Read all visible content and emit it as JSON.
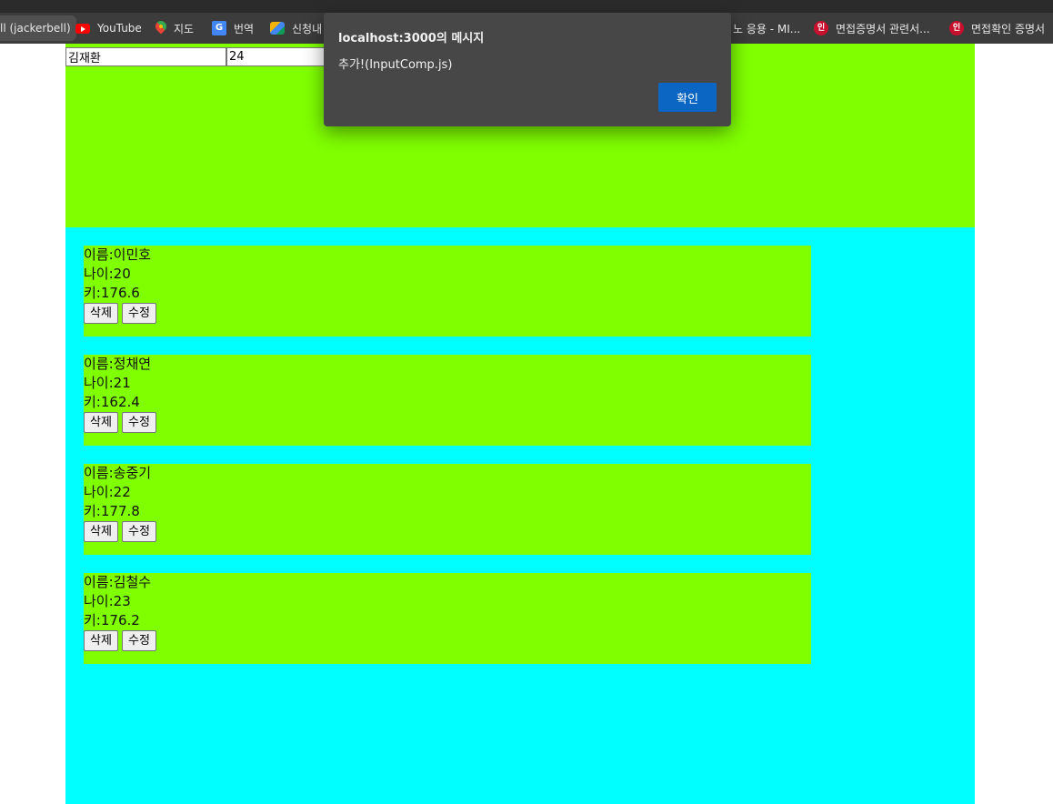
{
  "browser": {
    "bookmarks": [
      {
        "label": "ll (jackerbell)"
      },
      {
        "label": "YouTube",
        "icon": "youtube-icon"
      },
      {
        "label": "지도",
        "icon": "maps-icon"
      },
      {
        "label": "번역",
        "icon": "translate-icon"
      },
      {
        "label": "신청내",
        "icon": "app-icon"
      },
      {
        "label": "노 응용 - MI..."
      },
      {
        "label": "면접증명서 관련서...",
        "icon": "seal-icon"
      },
      {
        "label": "면접확인 증명서",
        "icon": "seal-icon"
      }
    ]
  },
  "form": {
    "name_value": "김재환",
    "age_value": "24"
  },
  "list": {
    "items": [
      {
        "name_line": "이름:이민호",
        "age_line": "나이:20",
        "height_line": "키:176.6"
      },
      {
        "name_line": "이름:정채연",
        "age_line": "나이:21",
        "height_line": "키:162.4"
      },
      {
        "name_line": "이름:송중기",
        "age_line": "나이:22",
        "height_line": "키:177.8"
      },
      {
        "name_line": "이름:김철수",
        "age_line": "나이:23",
        "height_line": "키:176.2"
      }
    ],
    "delete_label": "삭제",
    "edit_label": "수정"
  },
  "dialog": {
    "title": "localhost:3000의 메시지",
    "message": "추가!(InputComp.js)",
    "ok_label": "확인"
  },
  "colors": {
    "input_area_bg": "#7fff00",
    "list_area_bg": "#00ffff",
    "card_bg": "#7fff00",
    "dialog_button": "#0a66c2"
  }
}
